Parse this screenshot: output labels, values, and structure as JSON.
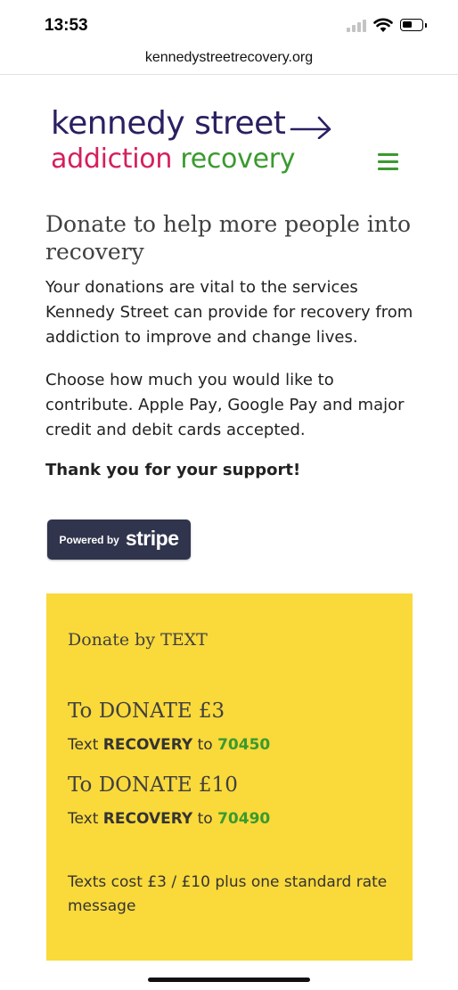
{
  "status_bar": {
    "time": "13:53"
  },
  "browser": {
    "url": "kennedystreetrecovery.org"
  },
  "logo": {
    "line1": "kennedy street",
    "word_addiction": "addiction",
    "word_recovery": "recovery",
    "colors": {
      "navy": "#2a2061",
      "pink": "#d51f5a",
      "green": "#3a9a2e"
    }
  },
  "main": {
    "title": "Donate to help more people into recovery",
    "paragraph1": "Your donations are vital to the services Kennedy Street can provide for recovery from addiction to improve and change lives.",
    "paragraph2": "Choose how much you would like to contribute. Apple Pay, Google Pay and major credit and debit cards accepted.",
    "thanks": "Thank you for your support!"
  },
  "stripe_button": {
    "small_label": "Powered by",
    "brand": "stripe"
  },
  "text_donate": {
    "heading": "Donate by TEXT",
    "options": [
      {
        "title": "To DONATE £3",
        "prefix": "Text ",
        "keyword": "RECOVERY",
        "to": " to ",
        "number": "70450"
      },
      {
        "title": "To DONATE £10",
        "prefix": "Text ",
        "keyword": "RECOVERY",
        "to": " to ",
        "number": "70490"
      }
    ],
    "note": "Texts cost £3 / £10 plus one standard rate message",
    "background": "#fad93b"
  }
}
